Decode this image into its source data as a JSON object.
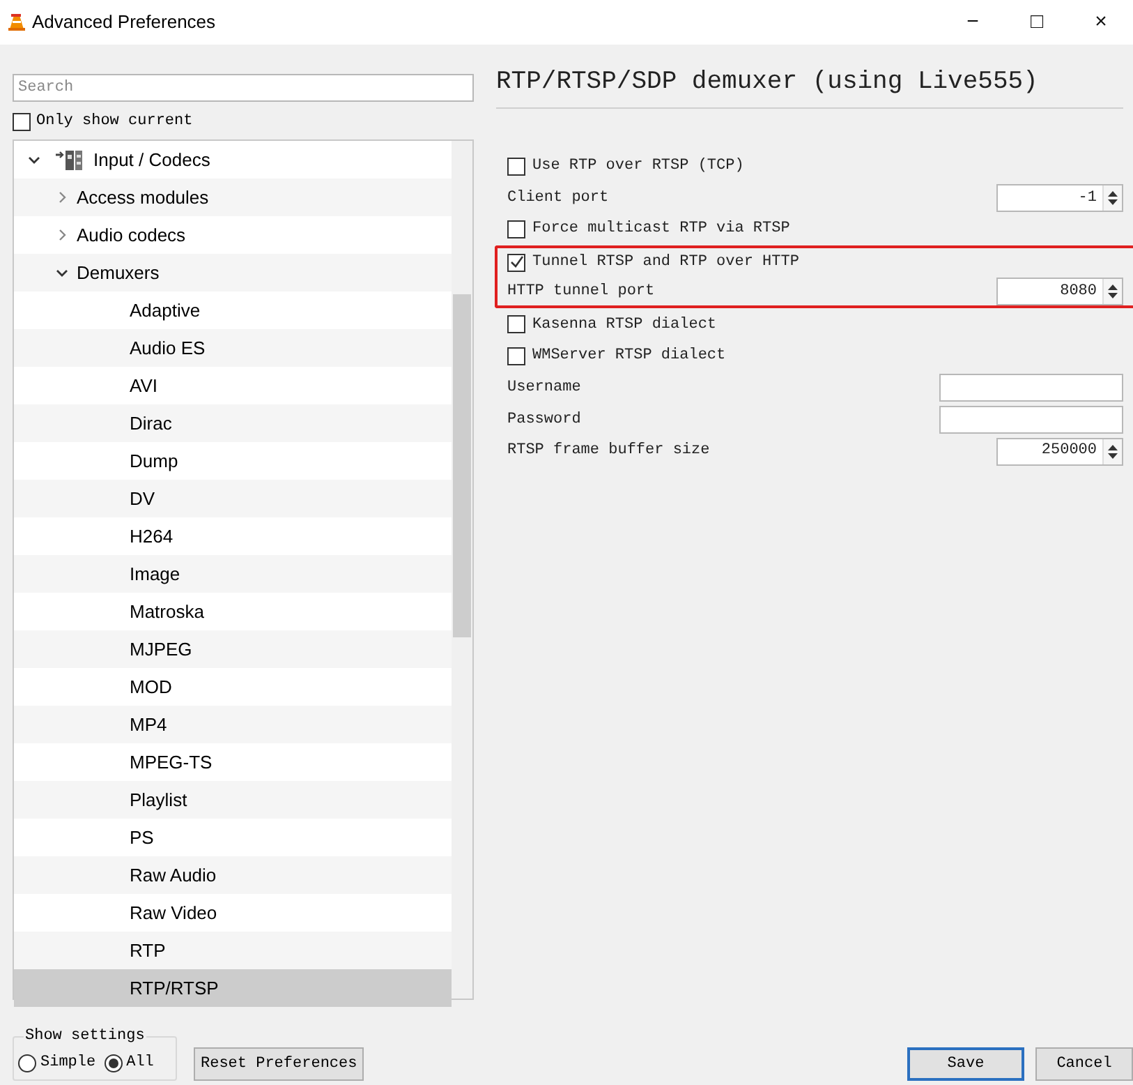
{
  "window": {
    "title": "Advanced Preferences",
    "controls": [
      "−",
      "□",
      "×"
    ]
  },
  "search": {
    "placeholder": "Search"
  },
  "only_show_current": {
    "label": "Only show current",
    "checked": false
  },
  "tree": [
    {
      "label": "Input / Codecs",
      "expanded": true,
      "selected": false,
      "children": [
        {
          "label": "Access modules",
          "expanded": false,
          "selected": false
        },
        {
          "label": "Audio codecs",
          "expanded": false,
          "selected": false
        },
        {
          "label": "Demuxers",
          "expanded": true,
          "selected": false,
          "children": [
            {
              "label": "Adaptive",
              "selected": false
            },
            {
              "label": "Audio ES",
              "selected": false
            },
            {
              "label": "AVI",
              "selected": false
            },
            {
              "label": "Dirac",
              "selected": false
            },
            {
              "label": "Dump",
              "selected": false
            },
            {
              "label": "DV",
              "selected": false
            },
            {
              "label": "H264",
              "selected": false
            },
            {
              "label": "Image",
              "selected": false
            },
            {
              "label": "Matroska",
              "selected": false
            },
            {
              "label": "MJPEG",
              "selected": false
            },
            {
              "label": "MOD",
              "selected": false
            },
            {
              "label": "MP4",
              "selected": false
            },
            {
              "label": "MPEG-TS",
              "selected": false
            },
            {
              "label": "Playlist",
              "selected": false
            },
            {
              "label": "PS",
              "selected": false
            },
            {
              "label": "Raw Audio",
              "selected": false
            },
            {
              "label": "Raw Video",
              "selected": false
            },
            {
              "label": "RTP",
              "selected": false
            },
            {
              "label": "RTP/RTSP",
              "selected": true
            }
          ]
        }
      ]
    }
  ],
  "panel": {
    "title": "RTP/RTSP/SDP demuxer (using Live555)"
  },
  "settings": [
    {
      "kind": "checkbox",
      "label": "Use RTP over RTSP (TCP)",
      "checked": false,
      "highlighted": false
    },
    {
      "kind": "spin",
      "label": "Client port",
      "value": "-1",
      "highlighted": false
    },
    {
      "kind": "checkbox",
      "label": "Force multicast RTP via RTSP",
      "checked": false,
      "highlighted": false
    },
    {
      "kind": "checkbox",
      "label": "Tunnel RTSP and RTP over HTTP",
      "checked": true,
      "highlighted": true
    },
    {
      "kind": "spin",
      "label": "HTTP tunnel port",
      "value": "8080",
      "highlighted": true
    },
    {
      "kind": "checkbox",
      "label": "Kasenna RTSP dialect",
      "checked": false,
      "highlighted": false
    },
    {
      "kind": "checkbox",
      "label": "WMServer RTSP dialect",
      "checked": false,
      "highlighted": false
    },
    {
      "kind": "text",
      "label": "Username",
      "highlighted": false
    },
    {
      "kind": "text",
      "label": "Password",
      "highlighted": false
    },
    {
      "kind": "spin",
      "label": "RTSP frame buffer size",
      "value": "250000",
      "highlighted": false
    }
  ],
  "show_settings": {
    "title": "Show settings",
    "options": [
      {
        "label": "Simple",
        "selected": false
      },
      {
        "label": "All",
        "selected": true
      }
    ]
  },
  "buttons": [
    {
      "label": "Reset Preferences",
      "kind": "reset"
    },
    {
      "label": "Save",
      "kind": "default"
    },
    {
      "label": "Cancel",
      "kind": "normal"
    }
  ]
}
